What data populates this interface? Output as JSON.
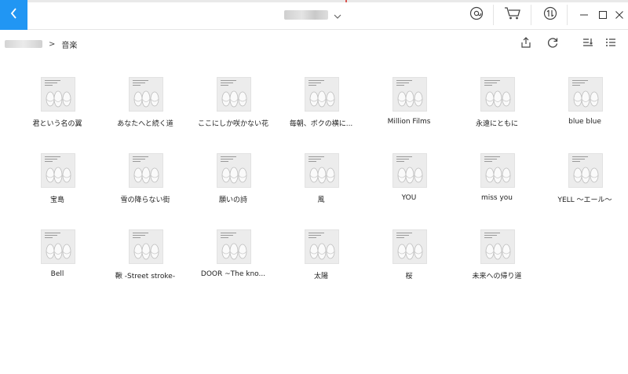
{
  "header": {
    "breadcrumb_separator": ">",
    "breadcrumb_current": "音楽"
  },
  "albums": [
    {
      "title": "君という名の翼"
    },
    {
      "title": "あなたへと続く道"
    },
    {
      "title": "ここにしか咲かない花"
    },
    {
      "title": "毎朝、ボクの横に..."
    },
    {
      "title": "Million Films"
    },
    {
      "title": "永遠にともに"
    },
    {
      "title": "blue blue"
    },
    {
      "title": "宝島"
    },
    {
      "title": "雪の降らない街"
    },
    {
      "title": "願いの詩"
    },
    {
      "title": "風"
    },
    {
      "title": "YOU"
    },
    {
      "title": "miss you"
    },
    {
      "title": "YELL ～エール～"
    },
    {
      "title": "Bell"
    },
    {
      "title": "鞦 -Street stroke-"
    },
    {
      "title": "DOOR ~The kno..."
    },
    {
      "title": "太陽"
    },
    {
      "title": "桜"
    },
    {
      "title": "未来への帰り道"
    }
  ],
  "colors": {
    "accent": "#2196f3",
    "icon": "#444444",
    "cover_bg": "#ececec"
  },
  "icons": {
    "back": "chevron-left-icon",
    "title_dropdown": "chevron-down-icon",
    "search": "at-icon",
    "store": "cart-icon",
    "transfer": "transfer-icon",
    "minimize": "minimize-icon",
    "maximize": "maximize-icon",
    "close": "close-icon",
    "export": "export-icon",
    "refresh": "refresh-icon",
    "sort": "sort-icon",
    "list_view": "list-view-icon"
  }
}
